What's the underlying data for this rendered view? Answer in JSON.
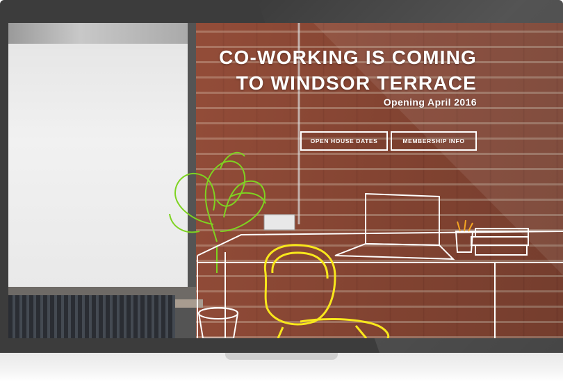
{
  "hero": {
    "title_line1": "CO-WORKING IS COMING",
    "title_line2": "TO WINDSOR TERRACE",
    "subtitle": "Opening April 2016"
  },
  "buttons": {
    "open_house": "OPEN HOUSE DATES",
    "membership": "MEMBERSHIP INFO"
  },
  "colors": {
    "plant_line": "#7ed321",
    "chair_line": "#f8e71c",
    "furniture_line": "#ffffff",
    "bezel": "#3c3c3c",
    "brick": "#8d4b37"
  }
}
